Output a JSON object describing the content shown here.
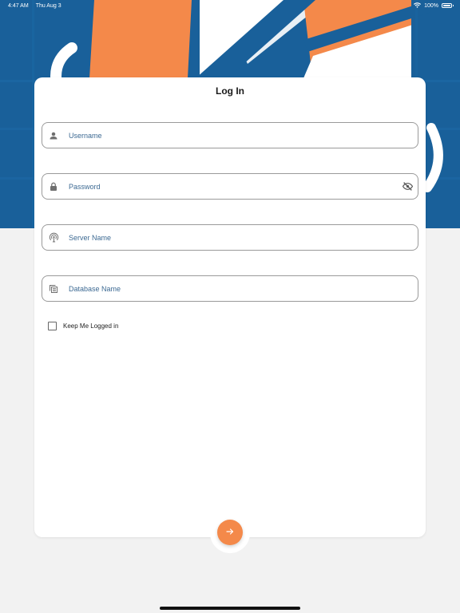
{
  "status_bar": {
    "time": "4:47 AM",
    "date": "Thu Aug 3",
    "center_dots": "• • •",
    "battery_percent": "100%",
    "battery_level": 1.0
  },
  "colors": {
    "brand_blue": "#19609a",
    "brand_orange": "#f4894a",
    "page_bg": "#f2f2f2",
    "input_text": "#3d6a93"
  },
  "login": {
    "title": "Log In",
    "fields": [
      {
        "name": "username",
        "placeholder": "Username",
        "value": "",
        "icon": "person-icon"
      },
      {
        "name": "password",
        "placeholder": "Password",
        "value": "",
        "icon": "lock-icon",
        "trailing_icon": "eye-off-icon"
      },
      {
        "name": "server",
        "placeholder": "Server Name",
        "value": "",
        "icon": "wifi-tethering-icon"
      },
      {
        "name": "database",
        "placeholder": "Database Name",
        "value": "",
        "icon": "database-stack-icon"
      }
    ],
    "remember_label": "Keep Me Logged in",
    "remember_checked": false,
    "submit_icon": "arrow-right-icon"
  }
}
